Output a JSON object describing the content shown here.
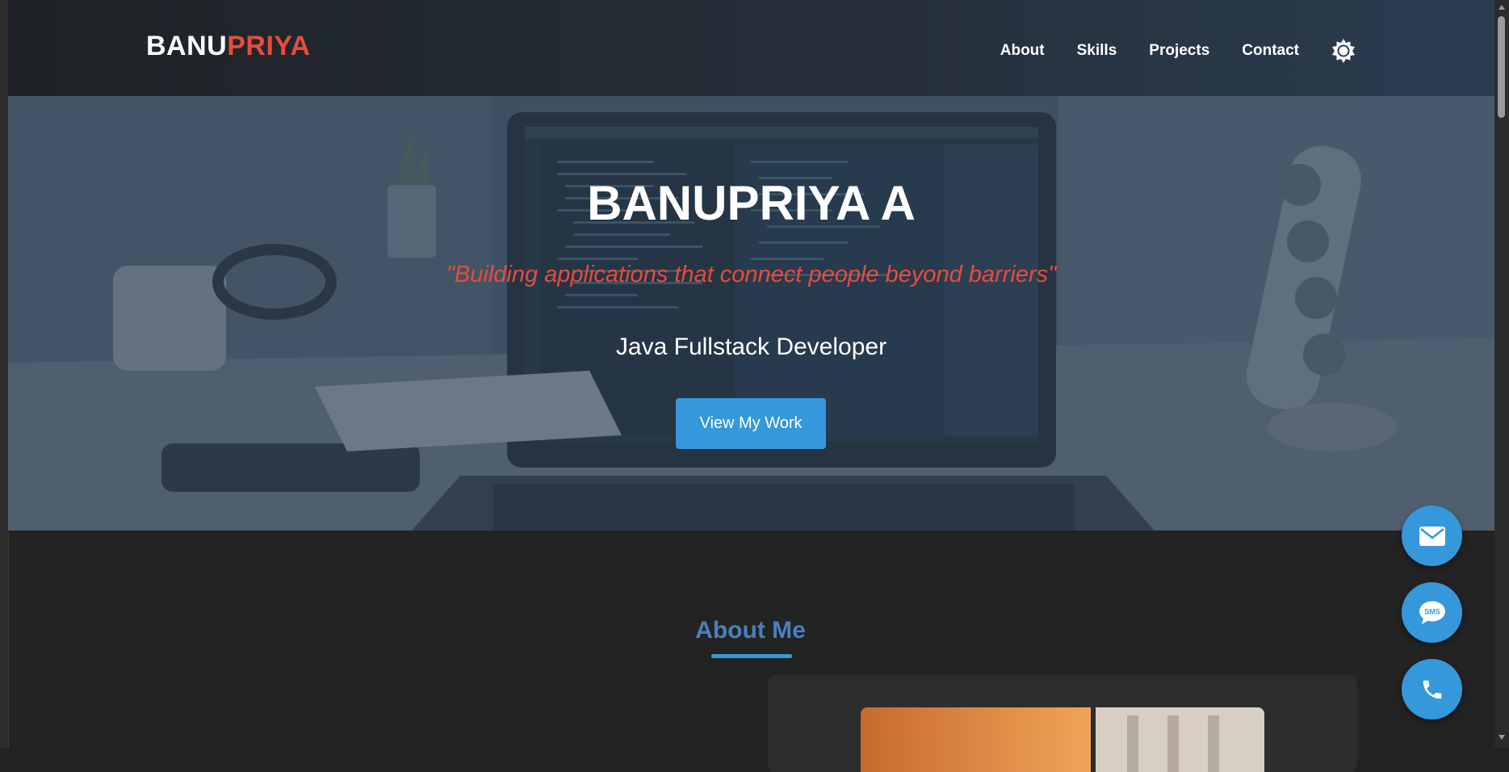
{
  "brand": {
    "first": "BANU",
    "second": "PRIYA",
    "color_first": "#ffffff",
    "color_second": "#e74c3c"
  },
  "nav": {
    "items": [
      {
        "label": "About"
      },
      {
        "label": "Skills"
      },
      {
        "label": "Projects"
      },
      {
        "label": "Contact"
      }
    ],
    "theme_toggle_icon": "sun-icon"
  },
  "hero": {
    "title": "BANUPRIYA A",
    "quote": "\"Building applications that connect people beyond barriers\"",
    "role": "Java Fullstack Developer",
    "cta_label": "View My Work"
  },
  "about": {
    "heading": "About Me"
  },
  "fabs": [
    {
      "icon": "mail-icon"
    },
    {
      "icon": "sms-icon",
      "label": "SMS"
    },
    {
      "icon": "phone-icon"
    }
  ],
  "colors": {
    "accent": "#3498db",
    "brand_red": "#e74c3c",
    "heading_blue": "#4a7fc1",
    "page_bg": "#232323"
  }
}
